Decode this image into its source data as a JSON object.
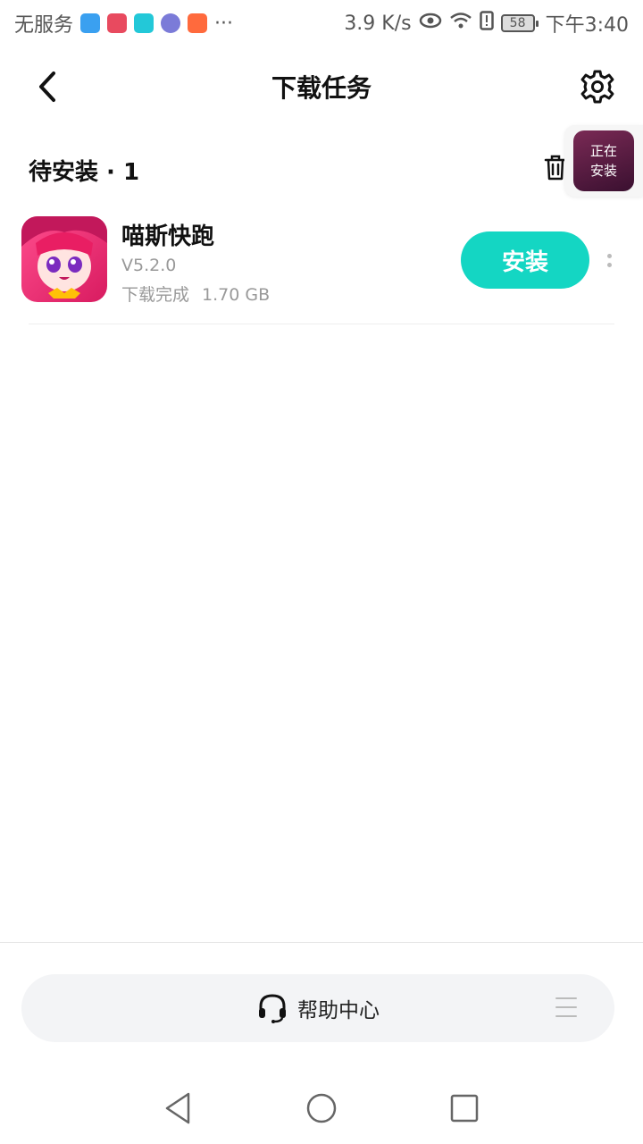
{
  "status_bar": {
    "carrier": "无服务",
    "more": "···",
    "speed": "3.9 K/s",
    "battery": "58",
    "time": "下午3:40",
    "mini_app_colors": [
      "#3aa0f0",
      "#e84a5f",
      "#23c8d8",
      "#7b7bd8",
      "#ff6a3d"
    ]
  },
  "header": {
    "title": "下载任务"
  },
  "section": {
    "title": "待安装 · 1"
  },
  "floating": {
    "line1": "正在",
    "line2": "安装"
  },
  "apps": [
    {
      "name": "喵斯快跑",
      "version": "V5.2.0",
      "status": "下载完成",
      "size": "1.70 GB",
      "action": "安装"
    }
  ],
  "help": {
    "label": "帮助中心"
  },
  "colors": {
    "accent": "#14d6c3",
    "help_bg": "#f3f4f6"
  },
  "icons": [
    "back-arrow-icon",
    "gear-icon",
    "trash-icon",
    "headset-icon",
    "menu-icon",
    "nav-back-icon",
    "nav-home-icon",
    "nav-recents-icon"
  ]
}
